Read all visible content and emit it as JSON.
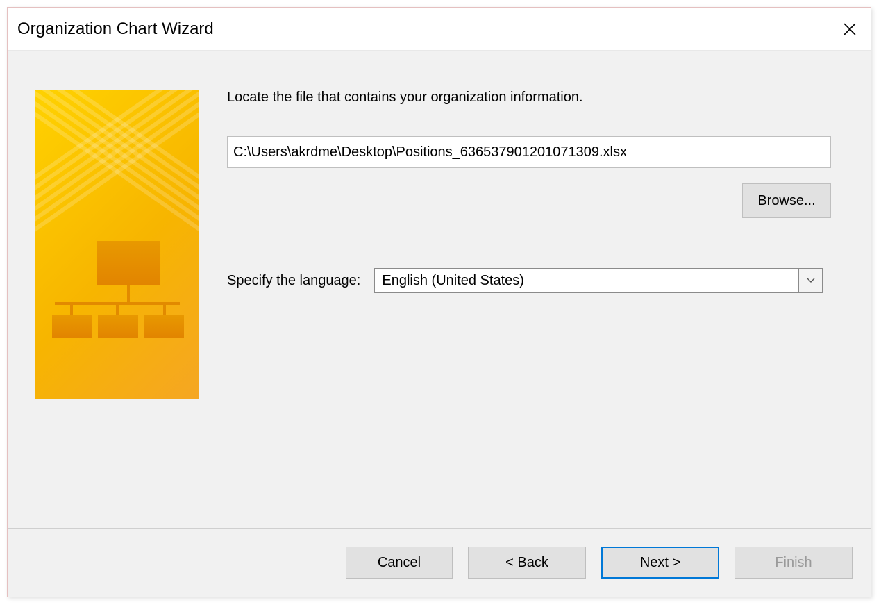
{
  "dialog": {
    "title": "Organization Chart Wizard",
    "close_icon": "close-icon"
  },
  "form": {
    "instruction": "Locate the file that contains your organization information.",
    "filepath_value": "C:\\Users\\akrdme\\Desktop\\Positions_636537901201071309.xlsx",
    "browse_label": "Browse...",
    "language_label": "Specify the language:",
    "language_value": "English (United States)"
  },
  "footer": {
    "cancel": "Cancel",
    "back": "< Back",
    "next": "Next >",
    "finish": "Finish"
  }
}
